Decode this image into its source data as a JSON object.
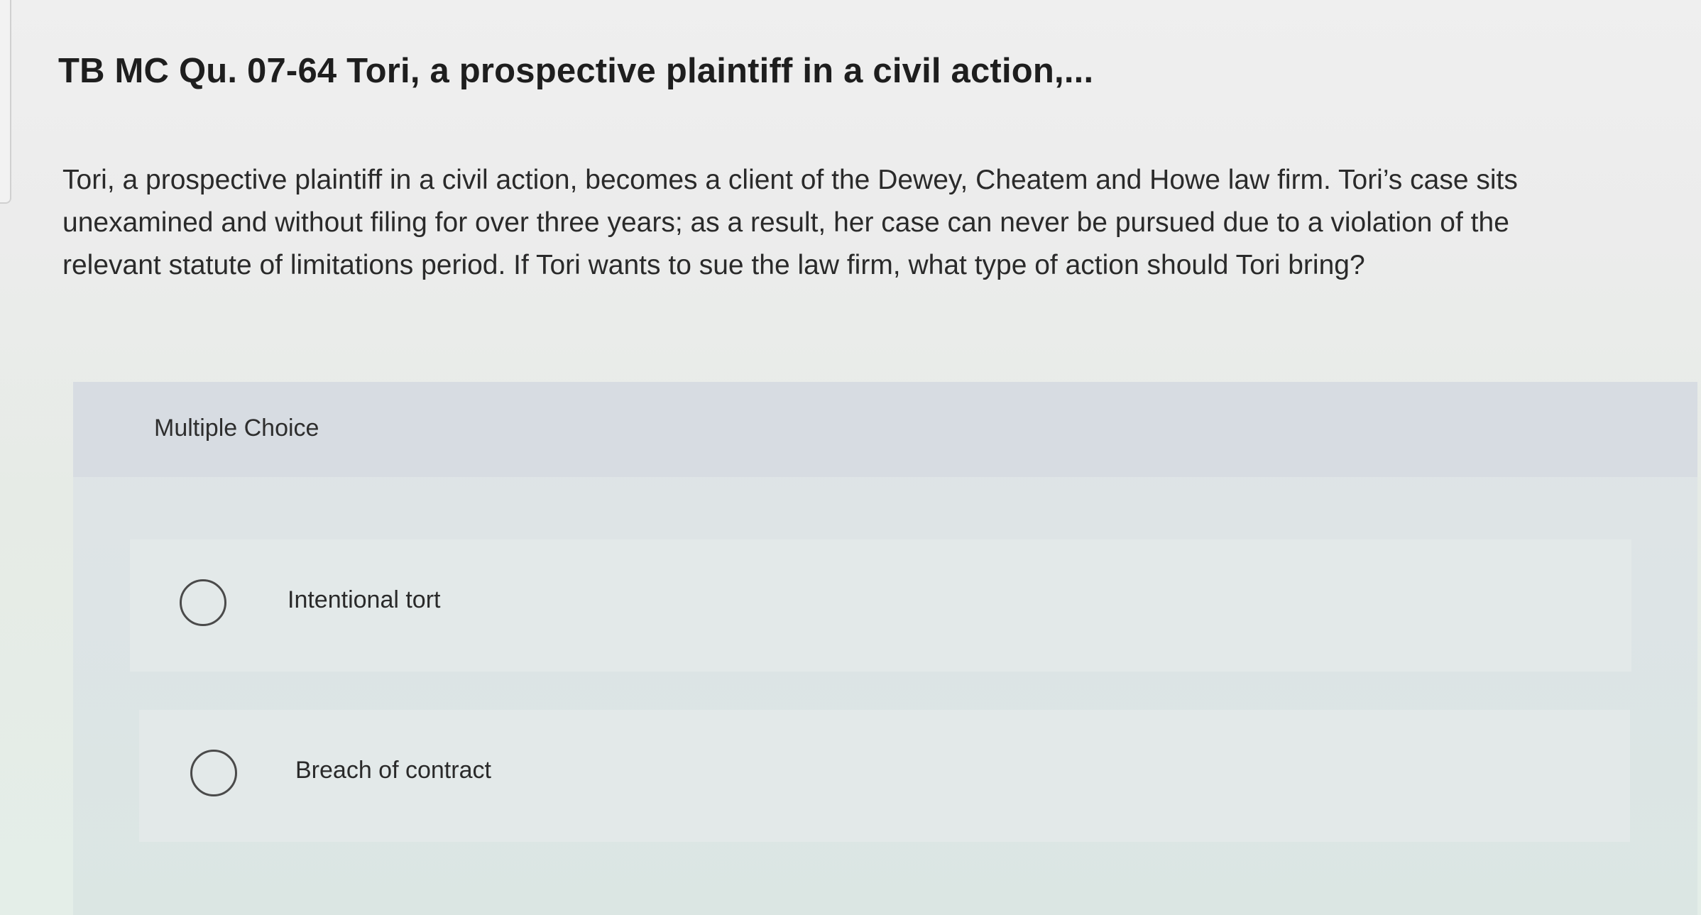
{
  "question": {
    "title": "TB MC Qu. 07-64 Tori, a prospective plaintiff in a civil action,...",
    "body_lines": [
      "Tori, a prospective plaintiff in a civil action, becomes a client of the Dewey, Cheatem and Howe law firm. Tori’s case sits",
      "unexamined and without filing for over three years; as a result, her case can never be pursued due to a violation of the",
      "relevant statute of limitations period. If Tori wants to sue the law firm, what type of action should Tori bring?"
    ]
  },
  "multiple_choice": {
    "label": "Multiple Choice",
    "options": [
      {
        "label": "Intentional tort",
        "selected": false
      },
      {
        "label": "Breach of contract",
        "selected": false
      }
    ]
  },
  "colors": {
    "panel_background": "#dfe3e7",
    "header_background": "#d7dce2",
    "text": "#2a2a2a",
    "radio_border": "#4a4a4a"
  },
  "icons": {
    "radio": "radio-button-unselected-icon"
  }
}
